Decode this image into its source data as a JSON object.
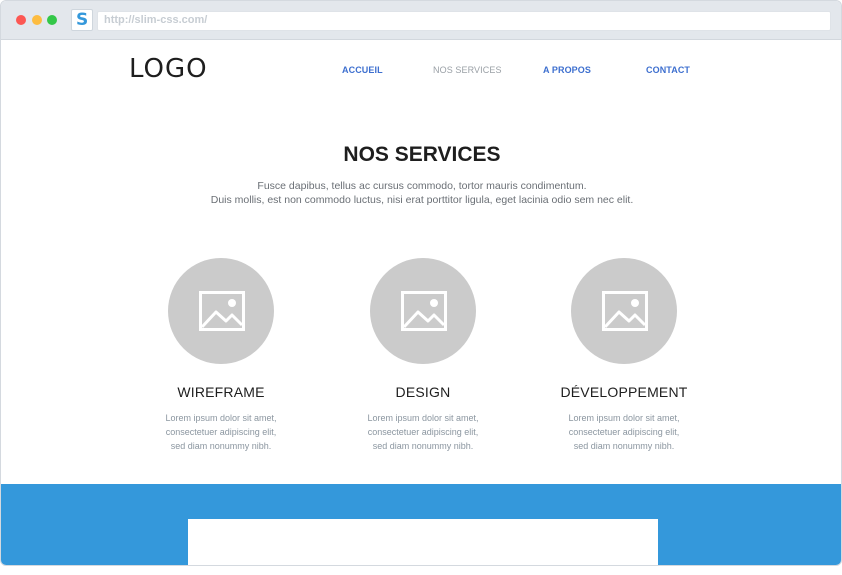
{
  "browser": {
    "url": "http://slim-css.com/",
    "favicon": "S",
    "colors": {
      "close": "#fc5753",
      "minimize": "#fdbc40",
      "zoom": "#33c748"
    }
  },
  "header": {
    "logo": "LOGO",
    "nav": [
      {
        "label": "ACCUEIL",
        "active": false
      },
      {
        "label": "NOS SERVICES",
        "active": true
      },
      {
        "label": "A PROPOS",
        "active": false
      },
      {
        "label": "CONTACT",
        "active": false
      }
    ]
  },
  "services": {
    "title": "NOS SERVICES",
    "intro_line1": "Fusce dapibus, tellus ac cursus commodo, tortor mauris condimentum.",
    "intro_line2": "Duis mollis, est non commodo luctus, nisi erat porttitor ligula, eget lacinia odio sem nec elit.",
    "items": [
      {
        "icon": "image-placeholder-icon",
        "title": "WIREFRAME",
        "text1": "Lorem ipsum dolor sit amet,",
        "text2": "consectetuer adipiscing elit,",
        "text3": "sed diam nonummy nibh."
      },
      {
        "icon": "image-placeholder-icon",
        "title": "DESIGN",
        "text1": "Lorem ipsum dolor sit amet,",
        "text2": "consectetuer adipiscing elit,",
        "text3": "sed diam nonummy nibh."
      },
      {
        "icon": "image-placeholder-icon",
        "title": "DÉVELOPPEMENT",
        "text1": "Lorem ipsum dolor sit amet,",
        "text2": "consectetuer adipiscing elit,",
        "text3": "sed diam nonummy nibh."
      }
    ]
  },
  "theme": {
    "accent": "#3498db",
    "nav_link": "#3d6fcf",
    "placeholder": "#cbcbcb"
  }
}
